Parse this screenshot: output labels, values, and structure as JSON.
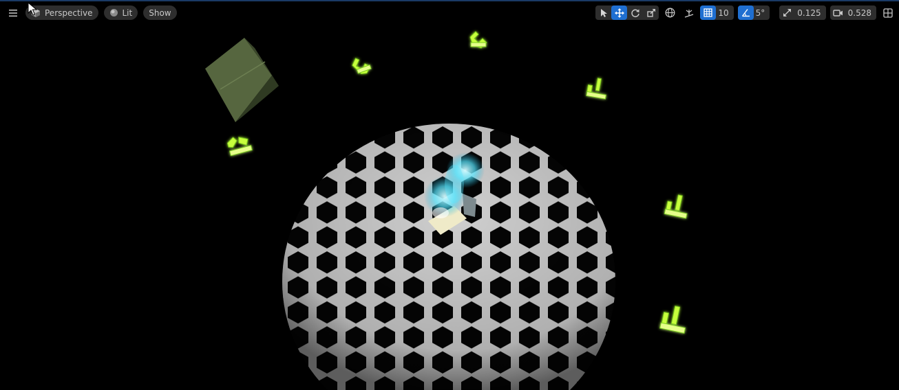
{
  "viewport": {
    "view_mode": "Perspective",
    "lighting_mode": "Lit",
    "show_label": "Show"
  },
  "toolbar": {
    "grid_snap_value": "10",
    "rotation_snap_value": "5°",
    "scale_snap_value": "0.125",
    "camera_speed_value": "0.528"
  },
  "colors": {
    "accent": "#1f6fd1",
    "button_bg": "#2e2e2e",
    "text": "#c8c8c8",
    "scene_bg": "#000000",
    "glow_green": "#c8ff3c",
    "hologram_cyan": "#55e6ff",
    "hex_floor": "#d8d8d8"
  },
  "icons": {
    "menu": "hamburger-menu-icon",
    "perspective": "cube-icon",
    "lit": "sphere-icon",
    "select": "arrow-cursor-icon",
    "translate": "move-arrows-icon",
    "rotate": "rotate-icon",
    "scale": "scale-icon",
    "world_local": "globe-icon",
    "surface_snap": "surface-snap-icon",
    "grid_snap": "grid-icon",
    "rotation_snap": "angle-icon",
    "scale_snap": "scale-arrow-icon",
    "camera_speed": "camera-icon",
    "layout": "viewport-layout-icon"
  }
}
